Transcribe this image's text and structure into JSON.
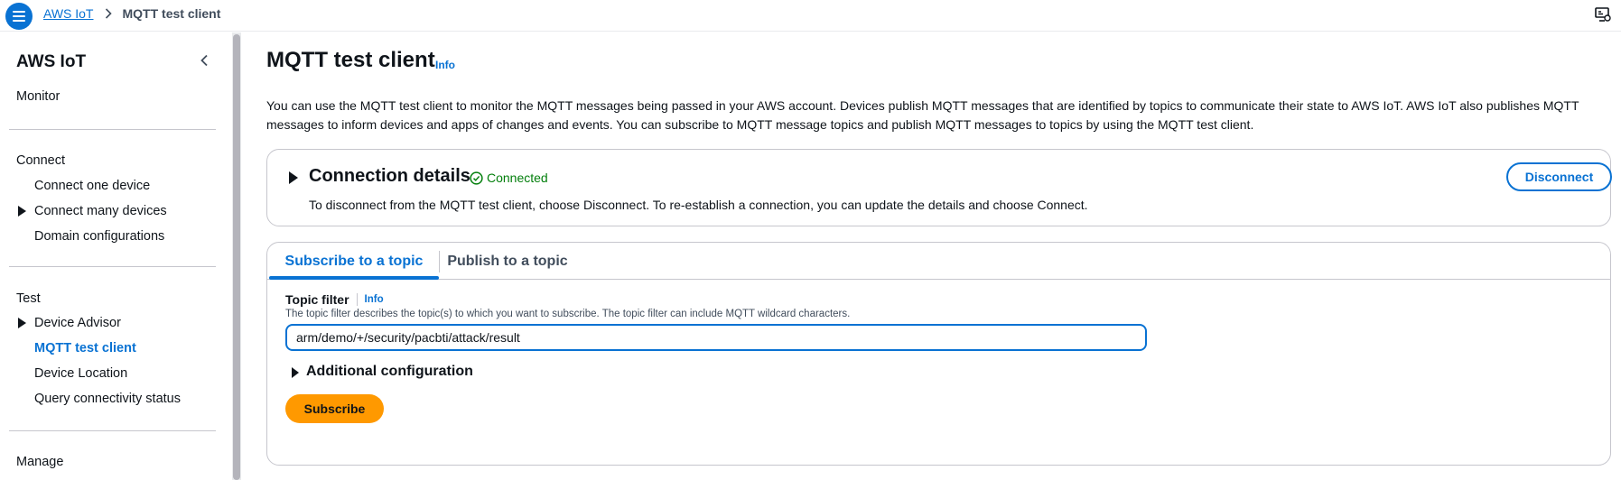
{
  "topbar": {
    "menu_icon": "hamburger-menu-icon",
    "breadcrumb": {
      "root": "AWS IoT",
      "current": "MQTT test client"
    },
    "right_icon": "screen-settings-icon"
  },
  "sidebar": {
    "title": "AWS IoT",
    "collapse_icon": "chevron-left-icon",
    "monitor": "Monitor",
    "connect_section": "Connect",
    "connect_items": [
      "Connect one device",
      "Connect many devices",
      "Domain configurations"
    ],
    "test_section": "Test",
    "test_items": [
      "Device Advisor",
      "MQTT test client",
      "Device Location",
      "Query connectivity status"
    ],
    "manage_section": "Manage",
    "active_item": "MQTT test client"
  },
  "main": {
    "title": "MQTT test client",
    "info": "Info",
    "description": "You can use the MQTT test client to monitor the MQTT messages being passed in your AWS account. Devices publish MQTT messages that are identified by topics to communicate their state to AWS IoT. AWS IoT also publishes MQTT messages to inform devices and apps of changes and events. You can subscribe to MQTT message topics and publish MQTT messages to topics by using the MQTT test client.",
    "connection": {
      "title": "Connection details",
      "status": "Connected",
      "status_color": "#037f0c",
      "description": "To disconnect from the MQTT test client, choose Disconnect. To re-establish a connection, you can update the details and choose Connect.",
      "disconnect_label": "Disconnect"
    },
    "tabs": [
      {
        "label": "Subscribe to a topic",
        "active": true
      },
      {
        "label": "Publish to a topic",
        "active": false
      }
    ],
    "subscribe": {
      "field_label": "Topic filter",
      "field_info": "Info",
      "field_desc": "The topic filter describes the topic(s) to which you want to subscribe. The topic filter can include MQTT wildcard characters.",
      "topic_value": "arm/demo/+/security/pacbti/attack/result",
      "additional_config": "Additional configuration",
      "subscribe_label": "Subscribe"
    }
  },
  "colors": {
    "accent": "#0972d3",
    "primary_button": "#ff9900",
    "border": "#c6c6cd"
  }
}
